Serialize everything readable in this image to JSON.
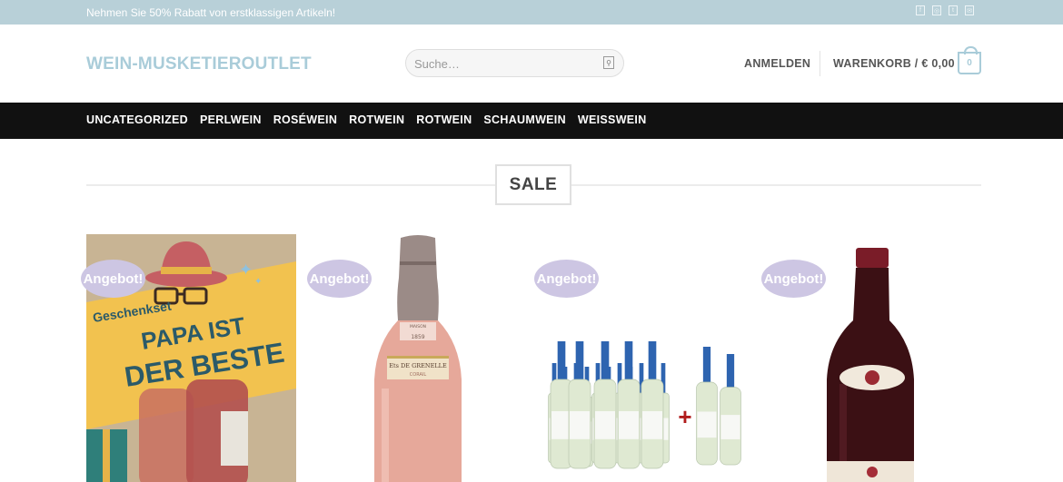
{
  "topbar": {
    "promo": "Nehmen Sie 50% Rabatt von erstklassigen Artikeln!",
    "social_icons": [
      "facebook-icon",
      "instagram-icon",
      "twitter-icon",
      "email-icon"
    ]
  },
  "header": {
    "logo": "WEIN-MUSKETIEROUTLET",
    "search_placeholder": "Suche…",
    "login": "ANMELDEN",
    "cart_label": "WARENKORB / € 0,00",
    "cart_count": "0"
  },
  "nav": {
    "items": [
      "UNCATEGORIZED",
      "PERLWEIN",
      "ROSÉWEIN",
      "ROTWEIN",
      "ROTWEIN",
      "SCHAUMWEIN",
      "WEISSWEIN"
    ]
  },
  "section": {
    "title": "SALE"
  },
  "products": [
    {
      "badge": "Angebot!",
      "image_text": {
        "line1": "Geschenkset",
        "line2": "PAPA IST",
        "line3": "DER BESTE"
      }
    },
    {
      "badge": "Angebot!",
      "label_top": "MAISON\nFONDÉE EN\n1859",
      "label_brand": "Ets DE GRENELLE",
      "label_sub": "CORAIL"
    },
    {
      "badge": "Angebot!",
      "plus_sign": "+"
    },
    {
      "badge": "Angebot!"
    }
  ],
  "colors": {
    "topbar": "#b8d0d8",
    "accent": "#a9ccd9",
    "nav_bg": "#111111",
    "badge": "#cdc6e3"
  }
}
